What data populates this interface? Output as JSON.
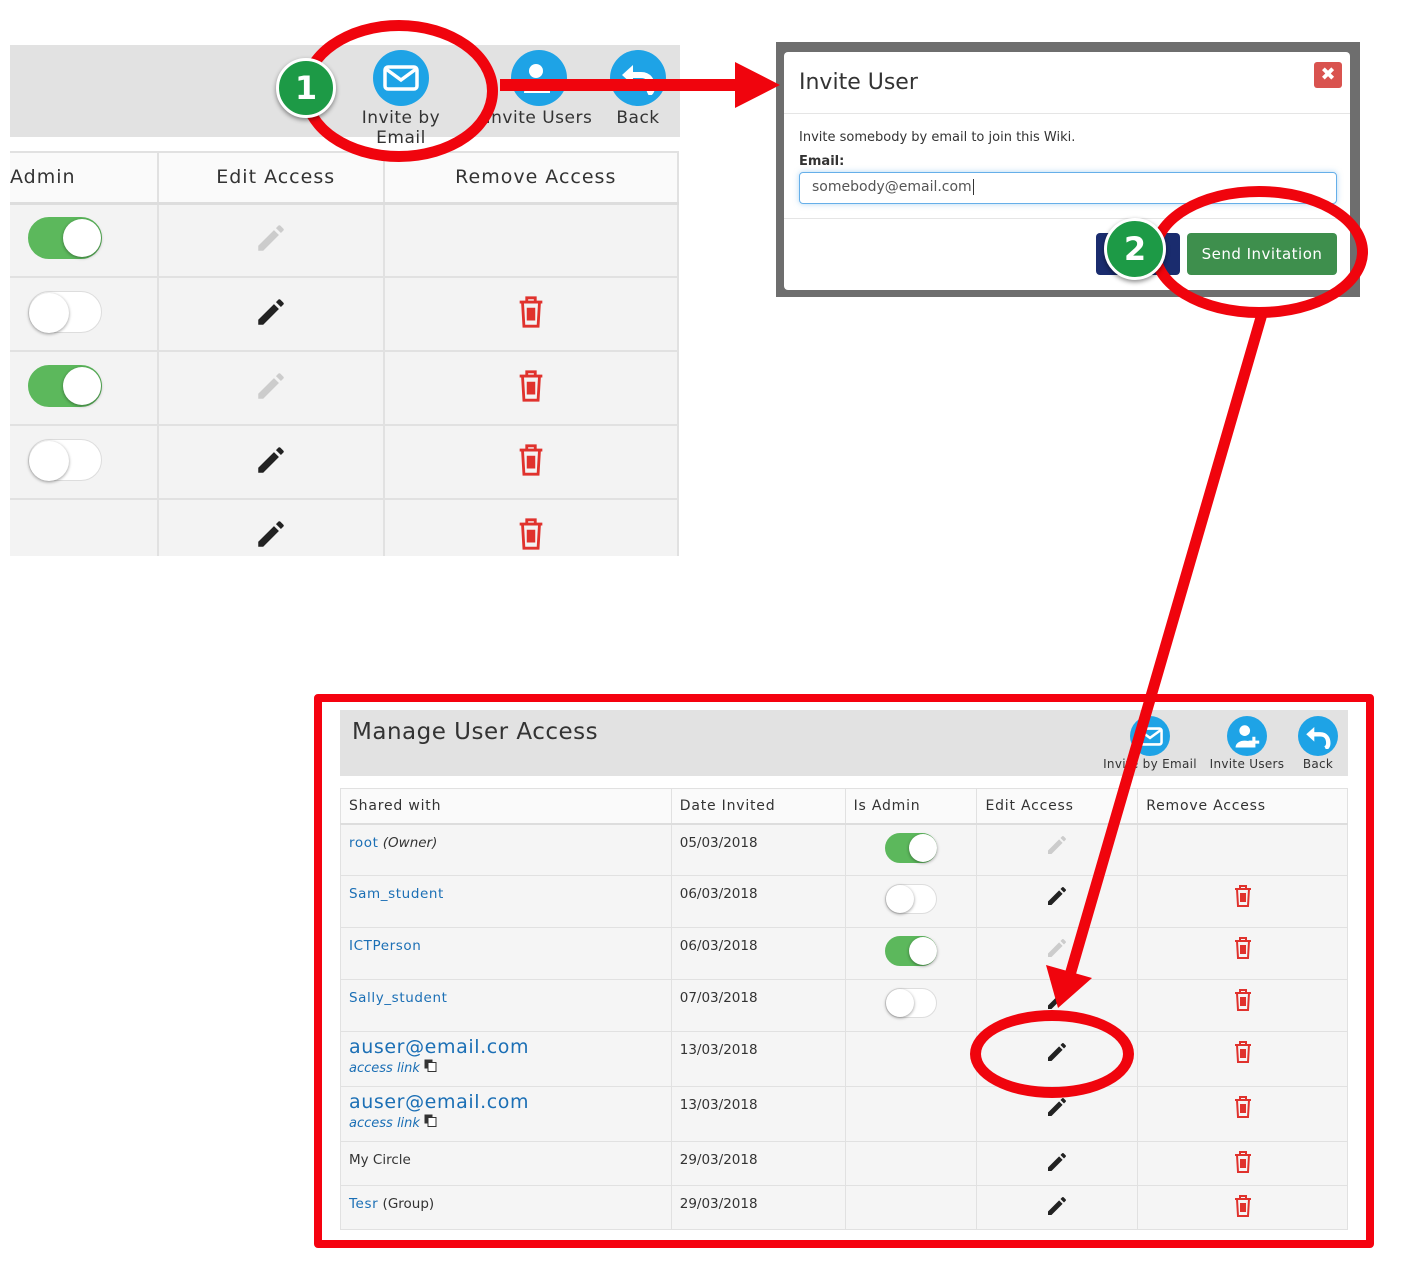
{
  "zoom_table": {
    "toolbar": {
      "invite_email_label": "Invite by Email",
      "invite_users_label": "Invite Users",
      "back_label": "Back"
    },
    "headers": [
      "Admin",
      "Edit Access",
      "Remove Access"
    ],
    "rows": [
      {
        "admin": true,
        "edit_enabled": false,
        "removable": false
      },
      {
        "admin": false,
        "edit_enabled": true,
        "removable": true
      },
      {
        "admin": true,
        "edit_enabled": false,
        "removable": true
      },
      {
        "admin": false,
        "edit_enabled": true,
        "removable": true
      },
      {
        "admin": null,
        "edit_enabled": true,
        "removable": true
      }
    ]
  },
  "modal": {
    "title": "Invite User",
    "close_glyph": "✖",
    "description": "Invite somebody by email to join this Wiki.",
    "email_label": "Email:",
    "email_value": "somebody@email.com",
    "send_label": "Send Invitation"
  },
  "steps": {
    "one": "1",
    "two": "2"
  },
  "manage": {
    "title": "Manage User Access",
    "toolbar": {
      "invite_email_label": "Invite by Email",
      "invite_users_label": "Invite Users",
      "back_label": "Back"
    },
    "headers": {
      "shared_with": "Shared with",
      "date_invited": "Date Invited",
      "is_admin": "Is Admin",
      "edit_access": "Edit Access",
      "remove_access": "Remove Access"
    },
    "rows": [
      {
        "name": "root",
        "suffix": "(Owner)",
        "date": "05/03/2018"
      },
      {
        "name": "Sam_student",
        "date": "06/03/2018"
      },
      {
        "name": "ICTPerson",
        "date": "06/03/2018"
      },
      {
        "name": "Sally_student",
        "date": "07/03/2018"
      },
      {
        "name": "auser@email.com",
        "access_link": "access link",
        "date": "13/03/2018"
      },
      {
        "name": "auser@email.com",
        "access_link": "access link",
        "date": "13/03/2018"
      },
      {
        "name": "My Circle",
        "date": "29/03/2018"
      },
      {
        "name": "Tesr",
        "suffix": "(Group)",
        "date": "29/03/2018"
      }
    ]
  },
  "colors": {
    "highlight_red": "#f0040d",
    "toggle_green": "#5cb85c",
    "icon_blue": "#1ea3e6",
    "trash_red": "#d9534f",
    "step_badge_green": "#1d9a46",
    "send_button_green": "#3e8f4d"
  }
}
